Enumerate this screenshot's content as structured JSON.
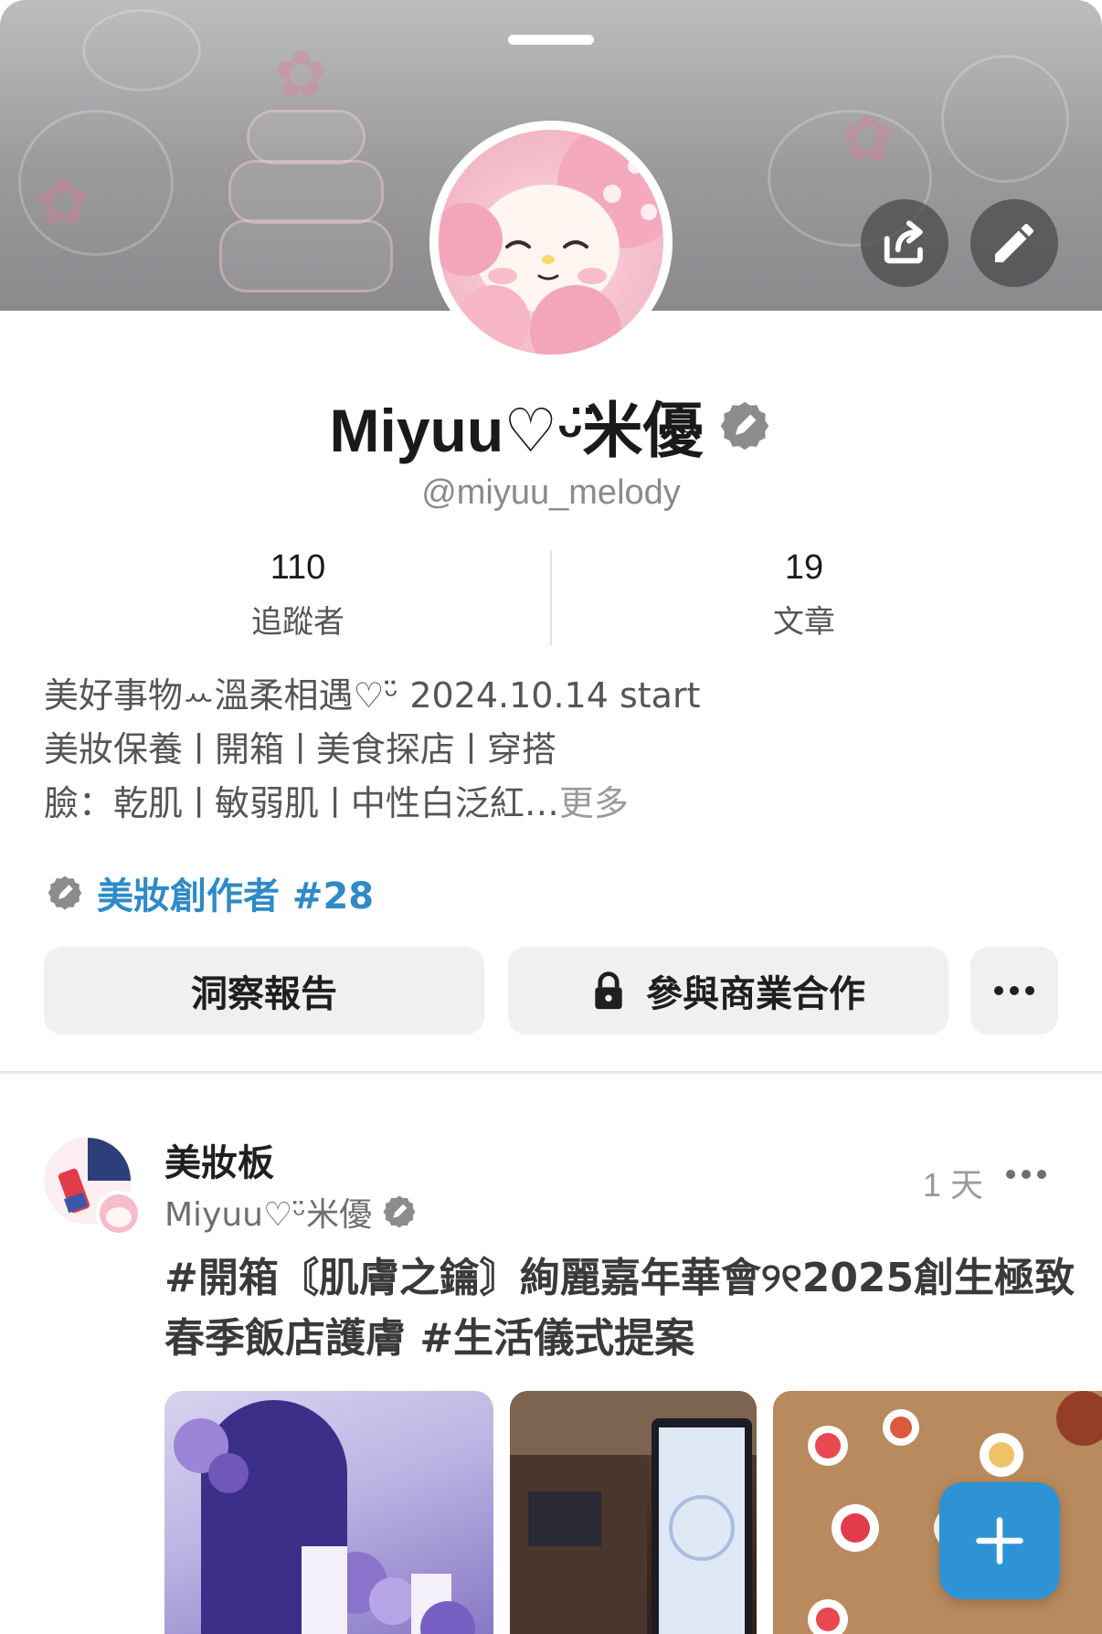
{
  "profile": {
    "display_name": "Miyuu♡ᵕ̈米優",
    "handle": "@miyuu_melody",
    "avatar_icon": "my-melody-avatar",
    "verified_icon": "pen-badge-icon"
  },
  "header": {
    "share_icon": "share-icon",
    "edit_icon": "pencil-icon"
  },
  "stats": [
    {
      "value": "110",
      "label": "追蹤者"
    },
    {
      "value": "19",
      "label": "文章"
    }
  ],
  "bio": {
    "line1": "美好事物ꕀ溫柔相遇♡ᵕ̈  2024.10.14 start",
    "line2": "美妝保養ㅣ開箱ㅣ美食探店ㅣ穿搭",
    "line3": "臉：乾肌ㅣ敏弱肌ㅣ中性白泛紅…",
    "more": "更多"
  },
  "creator": {
    "label": "美妝創作者 #28",
    "icon": "pen-badge-icon"
  },
  "actions": {
    "insight_label": "洞察報告",
    "business_label": "參與商業合作",
    "lock_icon": "lock-icon",
    "more_icon": "more-horizontal-icon"
  },
  "post": {
    "board": "美妝板",
    "author": "Miyuu♡ᵕ̈米優",
    "time": "1 天",
    "text": "#開箱〘肌膚之鑰〙絢麗嘉年華會୨୧2025創生極致春季飯店護膚 #生活儀式提案",
    "images": [
      "photo-1",
      "photo-2",
      "photo-3"
    ]
  },
  "fab": {
    "icon": "plus-icon"
  },
  "colors": {
    "accent": "#2d93d5",
    "creator_text": "#2f8ac8",
    "button_bg": "#f0f0f1"
  }
}
